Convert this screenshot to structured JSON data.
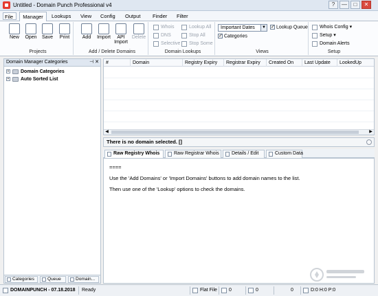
{
  "window": {
    "title": "Untitled - Domain Punch Professional v4",
    "buttons": [
      "?",
      "—",
      "□",
      "✕"
    ]
  },
  "menu": {
    "file": "File",
    "tabs": [
      "Manager",
      "Lookups",
      "View",
      "Config",
      "Output",
      "Finder",
      "Filter"
    ]
  },
  "ribbon": {
    "projects": {
      "label": "Projects",
      "buttons": [
        "New",
        "Open",
        "Save",
        "Print"
      ]
    },
    "add_delete": {
      "label": "Add / Delete Domains",
      "buttons": [
        "Add",
        "Import",
        "API Import",
        "Delete"
      ]
    },
    "lookups": {
      "label": "Domain Lookups",
      "small_buttons": [
        "Whois",
        "DNS",
        "Selective",
        "Lookup All",
        "Stop All",
        "Stop Some"
      ]
    },
    "views": {
      "label": "Views",
      "select_value": "Important Dates",
      "lookup_queue": "Lookup Queue",
      "categories": "Categories"
    },
    "setup": {
      "label": "Setup",
      "whois_config": "Whois Config",
      "setup": "Setup",
      "domain_alerts": "Domain Alerts"
    }
  },
  "left_panel": {
    "title": "Domain Manager Categories",
    "tools": "⊣ ✕",
    "items": [
      "Domain Categories",
      "Auto Sorted List"
    ],
    "tabs": [
      "Categories",
      "Queue",
      "Domain..."
    ]
  },
  "grid": {
    "columns": [
      "#",
      "Domain",
      "Registry Expiry",
      "Registrar Expiry",
      "Created On",
      "Last Update",
      "LookedUp"
    ],
    "scroll_left": "◀",
    "scroll_right": "▶"
  },
  "details": {
    "header": "There is no domain selected. []",
    "tabs": [
      "Raw Registry Whois",
      "Raw Registrar Whois",
      "Details / Edit",
      "Custom Data"
    ],
    "lines": [
      "====",
      "Use the 'Add Domains' or 'Import Domains' buttons to add domain names to the list.",
      "Then use one of the 'Lookup' options to check the domains."
    ]
  },
  "status": {
    "brand": "DOMAINPUNCH - 07.18.2018",
    "state": "Ready",
    "flat_file": "Flat File",
    "count1": "0",
    "count2": "0",
    "count3": "0",
    "counters": "D:0 H:0 P:0"
  }
}
